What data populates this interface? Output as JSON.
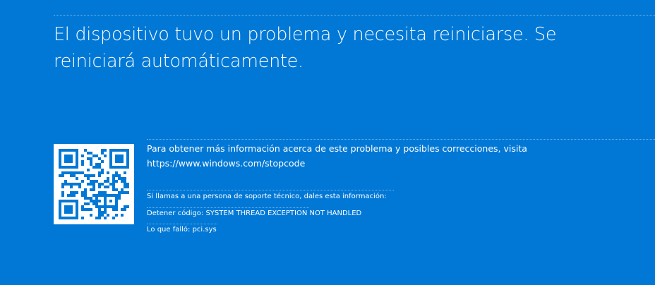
{
  "screen": {
    "background_color": "#0178d6",
    "text_color": "#ffffff"
  },
  "headline": "El dispositivo tuvo un problema y necesita reiniciarse. Se reiniciará automáticamente.",
  "info": {
    "line1": "Para obtener más información acerca de este problema y posibles correcciones, visita",
    "url": "https://www.windows.com/stopcode"
  },
  "support": {
    "text": "Si llamas a una persona de soporte técnico, dales esta información:",
    "stop_code": "Detener código: SYSTEM THREAD EXCEPTION NOT HANDLED",
    "what_failed": "Lo que falló: pci.sys"
  },
  "qr_code": {
    "icon": "qr-code-icon",
    "foreground_color": "#0178d6",
    "background_color": "#ffffff"
  }
}
